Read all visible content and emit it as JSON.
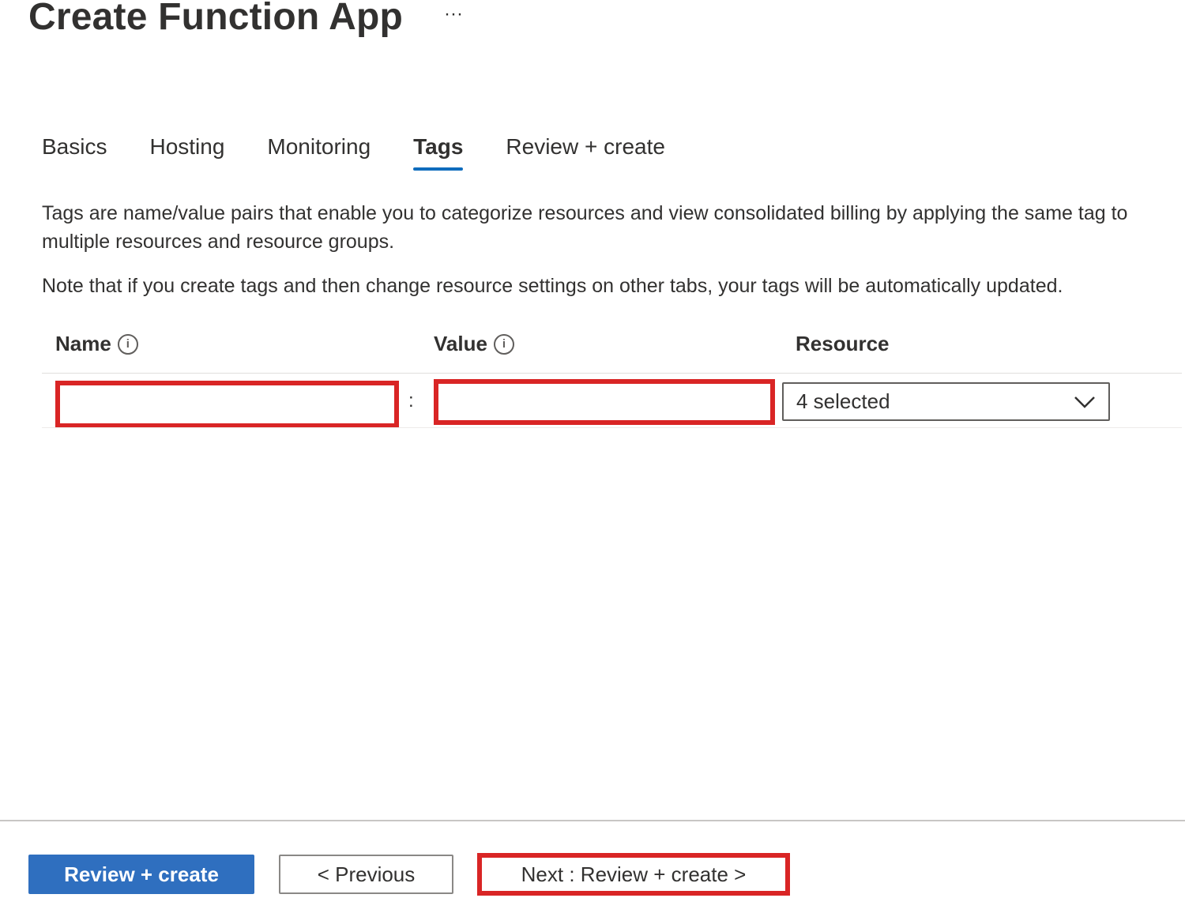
{
  "header": {
    "title": "Create Function App",
    "more_label": "···"
  },
  "tabs": [
    {
      "label": "Basics",
      "active": false
    },
    {
      "label": "Hosting",
      "active": false
    },
    {
      "label": "Monitoring",
      "active": false
    },
    {
      "label": "Tags",
      "active": true
    },
    {
      "label": "Review + create",
      "active": false
    }
  ],
  "description": {
    "paragraph1": "Tags are name/value pairs that enable you to categorize resources and view consolidated billing by applying the same tag to multiple resources and resource groups.",
    "paragraph2": "Note that if you create tags and then change resource settings on other tabs, your tags will be automatically updated."
  },
  "grid": {
    "columns": {
      "name": "Name",
      "value": "Value",
      "resource": "Resource"
    },
    "row": {
      "name_value": "",
      "separator": ":",
      "value_value": "",
      "resource_selected": "4 selected"
    },
    "info_icon_glyph": "i"
  },
  "footer": {
    "review_create_label": "Review + create",
    "previous_label": "< Previous",
    "next_label": "Next : Review + create >"
  },
  "colors": {
    "accent": "#0f6cbd",
    "primary_button": "#2f6fbf",
    "highlight_border": "#d92525"
  },
  "icons": {
    "more": "more-ellipsis-icon",
    "info": "info-icon",
    "chevron": "chevron-down-icon"
  }
}
